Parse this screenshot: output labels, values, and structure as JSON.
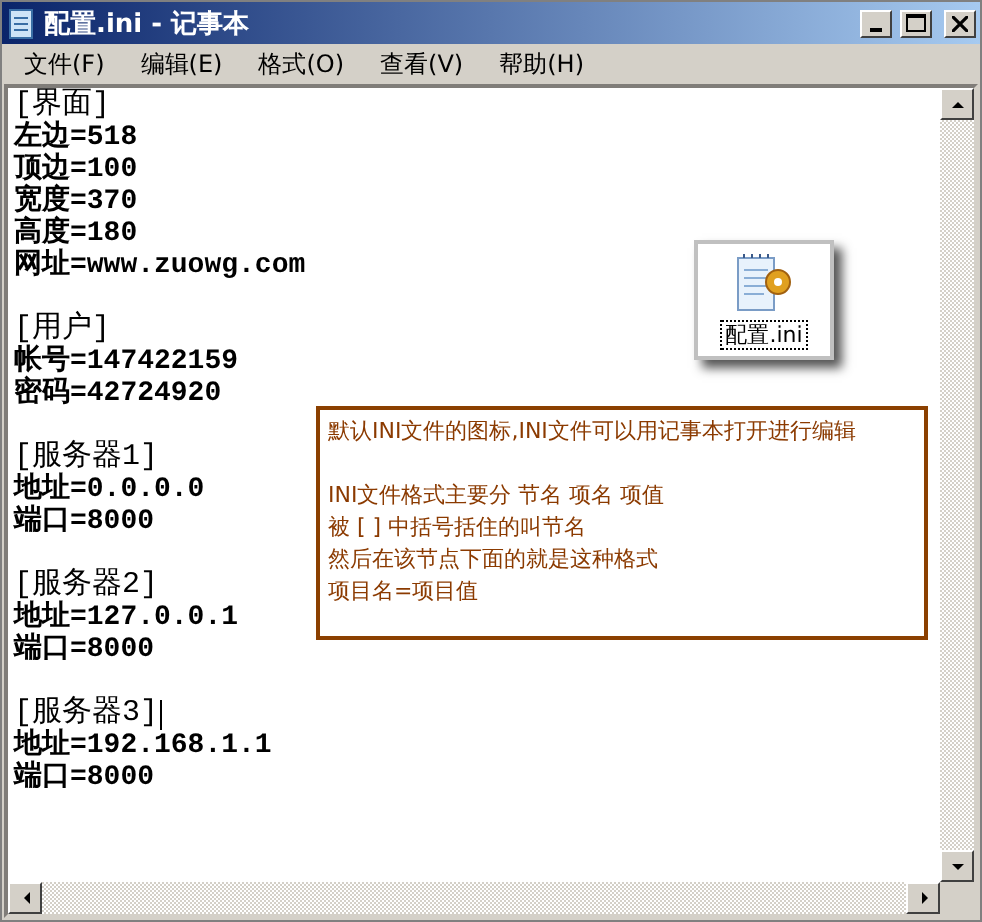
{
  "window": {
    "title": "配置.ini - 记事本"
  },
  "menu": [
    "文件(F)",
    "编辑(E)",
    "格式(O)",
    "查看(V)",
    "帮助(H)"
  ],
  "document": {
    "sections": [
      {
        "header": "[界面]",
        "cursor": false,
        "entries": [
          "左边=518",
          "顶边=100",
          "宽度=370",
          "高度=180",
          "网址=www.zuowg.com"
        ]
      },
      {
        "header": "[用户]",
        "cursor": false,
        "entries": [
          "帐号=147422159",
          "密码=42724920"
        ]
      },
      {
        "header": "[服务器1]",
        "cursor": false,
        "entries": [
          "地址=0.0.0.0",
          "端口=8000"
        ]
      },
      {
        "header": "[服务器2]",
        "cursor": false,
        "entries": [
          "地址=127.0.0.1",
          "端口=8000"
        ]
      },
      {
        "header": "[服务器3]",
        "cursor": true,
        "entries": [
          "地址=192.168.1.1",
          "端口=8000"
        ]
      }
    ]
  },
  "file_icon": {
    "label": "配置.ini"
  },
  "note": {
    "paragraphs": [
      [
        "默认INI文件的图标,INI文件可以用记事本打开进行编辑"
      ],
      [
        "INI文件格式主要分 节名 项名 项值",
        "被 [ ] 中括号括住的叫节名",
        "然后在该节点下面的就是这种格式",
        "项目名=项目值"
      ]
    ]
  }
}
